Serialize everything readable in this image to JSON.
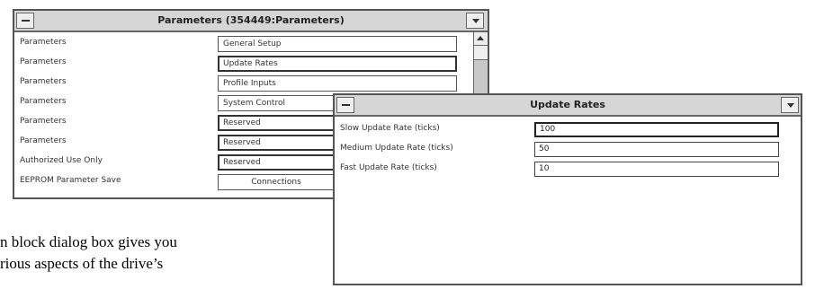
{
  "parameters_window": {
    "title": "Parameters (354449:Parameters)",
    "rows": [
      {
        "label": "Parameters",
        "button": "General Setup"
      },
      {
        "label": "Parameters",
        "button": "Update Rates"
      },
      {
        "label": "Parameters",
        "button": "Profile Inputs"
      },
      {
        "label": "Parameters",
        "button": "System Control"
      },
      {
        "label": "Parameters",
        "button": "Reserved"
      },
      {
        "label": "Parameters",
        "button": "Reserved"
      },
      {
        "label": "Authorized Use Only",
        "button": "Reserved"
      },
      {
        "label": "EEPROM Parameter Save",
        "button": "Connections"
      }
    ]
  },
  "update_rates_window": {
    "title": "Update Rates",
    "fields": [
      {
        "label": "Slow Update Rate (ticks)",
        "value": "100"
      },
      {
        "label": "Medium Update Rate (ticks)",
        "value": "50"
      },
      {
        "label": "Fast Update Rate (ticks)",
        "value": "10"
      }
    ]
  },
  "body_text": {
    "line1": "n block dialog box gives you",
    "line2": "rious aspects of the drive’s"
  }
}
